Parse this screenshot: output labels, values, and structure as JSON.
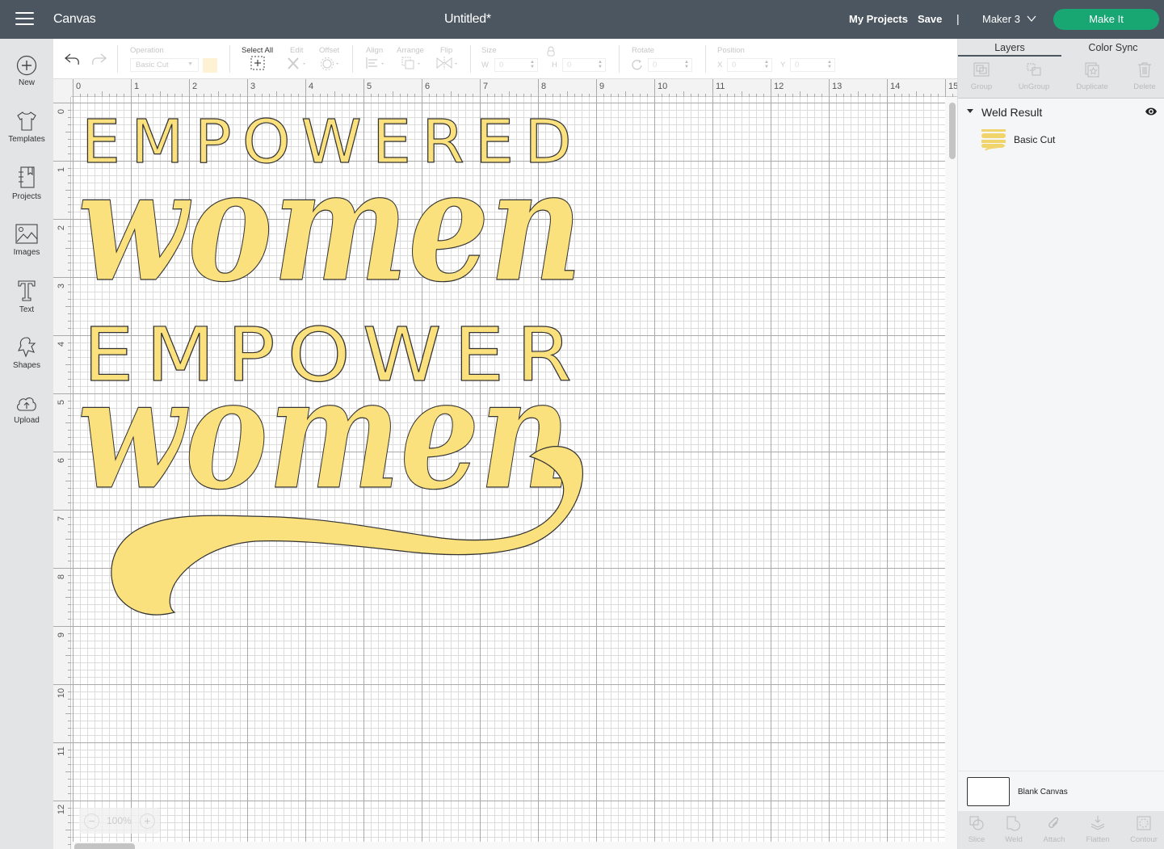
{
  "topbar": {
    "app_title": "Canvas",
    "doc_title": "Untitled*",
    "my_projects": "My Projects",
    "save": "Save",
    "separator": "|",
    "machine": "Maker 3",
    "make_it": "Make It",
    "accent_color": "#18a673"
  },
  "sidebar": {
    "items": [
      {
        "label": "New",
        "icon": "plus-circle-icon"
      },
      {
        "label": "Templates",
        "icon": "tshirt-icon"
      },
      {
        "label": "Projects",
        "icon": "notebook-icon"
      },
      {
        "label": "Images",
        "icon": "image-icon"
      },
      {
        "label": "Text",
        "icon": "text-t-icon"
      },
      {
        "label": "Shapes",
        "icon": "shapes-icon"
      },
      {
        "label": "Upload",
        "icon": "cloud-upload-icon"
      }
    ]
  },
  "toolbar": {
    "operation_label": "Operation",
    "operation_value": "Basic Cut",
    "select_all": "Select All",
    "edit": "Edit",
    "offset": "Offset",
    "align": "Align",
    "arrange": "Arrange",
    "flip": "Flip",
    "size": "Size",
    "w_label": "W",
    "w_value": "0",
    "h_label": "H",
    "h_value": "0",
    "rotate": "Rotate",
    "rotate_value": "0",
    "position": "Position",
    "x_label": "X",
    "x_value": "0",
    "y_label": "Y",
    "y_value": "0"
  },
  "canvas": {
    "ruler_top": [
      "0",
      "1",
      "2",
      "3",
      "4",
      "5",
      "6",
      "7",
      "8",
      "9",
      "10",
      "11",
      "12",
      "13",
      "14",
      "15"
    ],
    "ruler_left": [
      "0",
      "1",
      "2",
      "3",
      "4",
      "5",
      "6",
      "7",
      "8",
      "9",
      "10",
      "11",
      "12"
    ],
    "zoom_level": "100%",
    "zoom_out": "−",
    "zoom_in": "+",
    "artwork": {
      "line1": "EMPOWERED",
      "line2": "women",
      "line3": "EMPOWER",
      "line4": "women",
      "fill_color": "#fae17d",
      "stroke_color": "#333333"
    }
  },
  "right_panel": {
    "tabs": [
      {
        "label": "Layers",
        "active": true
      },
      {
        "label": "Color Sync",
        "active": false
      }
    ],
    "layer_actions": [
      "Group",
      "UnGroup",
      "Duplicate",
      "Delete"
    ],
    "group_name": "Weld Result",
    "layers": [
      {
        "name": "Basic Cut"
      }
    ],
    "blank_canvas": "Blank Canvas",
    "bottom_actions": [
      "Slice",
      "Weld",
      "Attach",
      "Flatten",
      "Contour"
    ]
  }
}
